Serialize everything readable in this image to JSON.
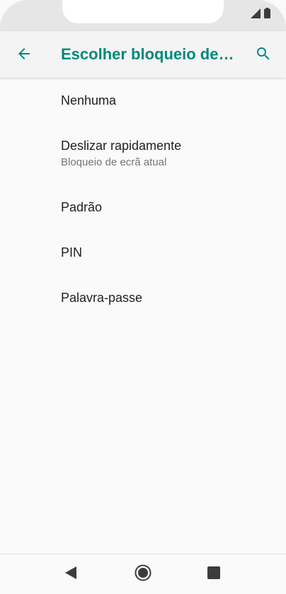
{
  "app_bar": {
    "title": "Escolher bloqueio de ecrã"
  },
  "list": {
    "items": [
      {
        "title": "Nenhuma",
        "subtitle": ""
      },
      {
        "title": "Deslizar rapidamente",
        "subtitle": "Bloqueio de ecrã atual"
      },
      {
        "title": "Padrão",
        "subtitle": ""
      },
      {
        "title": "PIN",
        "subtitle": ""
      },
      {
        "title": "Palavra-passe",
        "subtitle": ""
      }
    ]
  },
  "colors": {
    "accent": "#00897b",
    "text_primary": "#212121",
    "text_secondary": "#757575",
    "background": "#fafafa"
  },
  "icons": {
    "back": "arrow-back-icon",
    "search": "search-icon",
    "signal": "signal-icon",
    "battery": "battery-icon",
    "nav_back": "nav-back-icon",
    "nav_home": "nav-home-icon",
    "nav_recents": "nav-recents-icon"
  }
}
